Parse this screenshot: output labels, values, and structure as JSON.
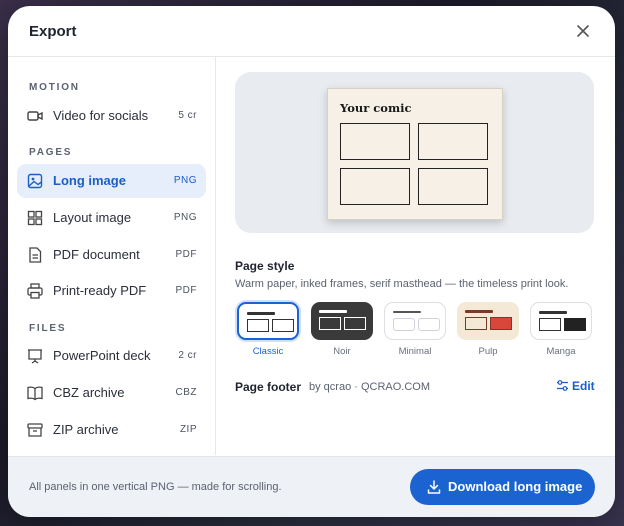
{
  "dialog": {
    "title": "Export"
  },
  "sidebar": {
    "sections": [
      {
        "heading": "MOTION",
        "items": [
          {
            "label": "Video for socials",
            "tag": "5 cr",
            "icon": "video-icon"
          }
        ]
      },
      {
        "heading": "PAGES",
        "items": [
          {
            "label": "Long image",
            "tag": "PNG",
            "icon": "image-icon",
            "active": true
          },
          {
            "label": "Layout image",
            "tag": "PNG",
            "icon": "grid-icon"
          },
          {
            "label": "PDF document",
            "tag": "PDF",
            "icon": "document-icon"
          },
          {
            "label": "Print-ready PDF",
            "tag": "PDF",
            "icon": "printer-icon"
          }
        ]
      },
      {
        "heading": "FILES",
        "items": [
          {
            "label": "PowerPoint deck",
            "tag": "2 cr",
            "icon": "presentation-icon"
          },
          {
            "label": "CBZ archive",
            "tag": "CBZ",
            "icon": "book-icon"
          },
          {
            "label": "ZIP archive",
            "tag": "ZIP",
            "icon": "archive-icon"
          }
        ]
      }
    ]
  },
  "preview": {
    "comic_title": "Your comic"
  },
  "page_style": {
    "label": "Page style",
    "description": "Warm paper, inked frames, serif masthead — the timeless print look.",
    "selected": "Classic",
    "options": [
      {
        "name": "Classic",
        "bg": "#ffffff",
        "accent": "#1a63d0"
      },
      {
        "name": "Noir",
        "bg": "#3a3a3a",
        "accent": "#ffffff"
      },
      {
        "name": "Minimal",
        "bg": "#ffffff",
        "accent": "#888888"
      },
      {
        "name": "Pulp",
        "bg": "#f4e8d6",
        "accent": "#d9473a"
      },
      {
        "name": "Manga",
        "bg": "#ffffff",
        "accent": "#222222"
      }
    ]
  },
  "page_footer": {
    "label": "Page footer",
    "value": "by qcrao · QCRAO.COM",
    "edit_label": "Edit"
  },
  "bottom_bar": {
    "info": "All panels in one vertical PNG — made for scrolling.",
    "download_label": "Download long image"
  }
}
